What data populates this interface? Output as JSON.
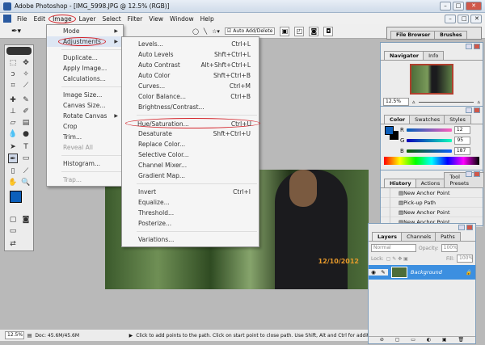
{
  "window": {
    "title": "Adobe Photoshop - [IMG_5998.JPG @ 12.5% (RGB)]",
    "minimize": "–",
    "maximize": "□",
    "close": "✕"
  },
  "menubar": [
    "File",
    "Edit",
    "Image",
    "Layer",
    "Select",
    "Filter",
    "View",
    "Window",
    "Help"
  ],
  "options": {
    "auto_add_delete": "Auto Add/Delete"
  },
  "image_menu": [
    {
      "label": "Mode",
      "sub": true
    },
    {
      "label": "Adjustments",
      "sub": true
    },
    {
      "sep": true
    },
    {
      "label": "Duplicate..."
    },
    {
      "label": "Apply Image..."
    },
    {
      "label": "Calculations..."
    },
    {
      "sep": true
    },
    {
      "label": "Image Size..."
    },
    {
      "label": "Canvas Size..."
    },
    {
      "label": "Rotate Canvas",
      "sub": true
    },
    {
      "label": "Crop"
    },
    {
      "label": "Trim..."
    },
    {
      "label": "Reveal All",
      "disabled": true
    },
    {
      "sep": true
    },
    {
      "label": "Histogram..."
    },
    {
      "sep": true
    },
    {
      "label": "Trap...",
      "disabled": true
    }
  ],
  "adjustments_menu": [
    {
      "label": "Levels...",
      "shortcut": "Ctrl+L"
    },
    {
      "label": "Auto Levels",
      "shortcut": "Shft+Ctrl+L"
    },
    {
      "label": "Auto Contrast",
      "shortcut": "Alt+Shft+Ctrl+L"
    },
    {
      "label": "Auto Color",
      "shortcut": "Shft+Ctrl+B"
    },
    {
      "label": "Curves...",
      "shortcut": "Ctrl+M"
    },
    {
      "label": "Color Balance...",
      "shortcut": "Ctrl+B"
    },
    {
      "label": "Brightness/Contrast..."
    },
    {
      "sep": true
    },
    {
      "label": "Hue/Saturation...",
      "shortcut": "Ctrl+U"
    },
    {
      "label": "Desaturate",
      "shortcut": "Shft+Ctrl+U"
    },
    {
      "label": "Replace Color..."
    },
    {
      "label": "Selective Color..."
    },
    {
      "label": "Channel Mixer..."
    },
    {
      "label": "Gradient Map..."
    },
    {
      "sep": true
    },
    {
      "label": "Invert",
      "shortcut": "Ctrl+I"
    },
    {
      "label": "Equalize..."
    },
    {
      "label": "Threshold..."
    },
    {
      "label": "Posterize..."
    },
    {
      "sep": true
    },
    {
      "label": "Variations..."
    }
  ],
  "palette_well": [
    "File Browser",
    "Brushes"
  ],
  "navigator": {
    "tabs": [
      "Navigator",
      "Info"
    ],
    "zoom": "12.5%"
  },
  "color": {
    "tabs": [
      "Color",
      "Swatches",
      "Styles"
    ],
    "r": "12",
    "g": "95",
    "b": "187",
    "r_label": "R",
    "g_label": "G",
    "b_label": "B",
    "foreground": "#0c5fbb"
  },
  "history": {
    "tabs": [
      "History",
      "Actions",
      "Tool Presets"
    ],
    "items": [
      "New Anchor Point",
      "Pick-up Path",
      "New Anchor Point",
      "New Anchor Point"
    ]
  },
  "layers": {
    "tabs": [
      "Layers",
      "Channels",
      "Paths"
    ],
    "blend": "Normal",
    "opacity_label": "Opacity:",
    "opacity": "100%",
    "lock_label": "Lock:",
    "fill_label": "Fill:",
    "fill": "100%",
    "layer": "Background"
  },
  "canvas": {
    "datestamp": "12/10/2012"
  },
  "status": {
    "zoom": "12.5%",
    "doc": "Doc: 45.6M/45.6M",
    "hint": "Click to add points to the path.  Click on start point to close path.  Use Shift, Alt and Ctrl for additional optio"
  }
}
